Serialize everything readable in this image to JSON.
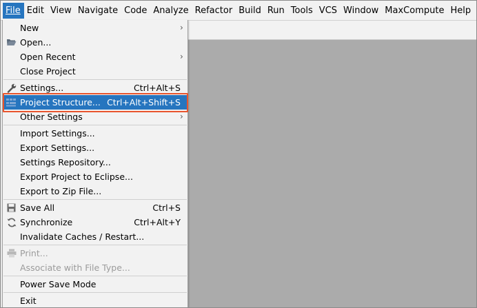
{
  "menubar": {
    "items": [
      "File",
      "Edit",
      "View",
      "Navigate",
      "Code",
      "Analyze",
      "Refactor",
      "Build",
      "Run",
      "Tools",
      "VCS",
      "Window",
      "MaxCompute",
      "Help"
    ]
  },
  "file_menu": {
    "new": "New",
    "open": "Open...",
    "open_recent": "Open Recent",
    "close_project": "Close Project",
    "settings": "Settings...",
    "settings_shortcut": "Ctrl+Alt+S",
    "project_structure": "Project Structure...",
    "project_structure_shortcut": "Ctrl+Alt+Shift+S",
    "other_settings": "Other Settings",
    "import_settings": "Import Settings...",
    "export_settings": "Export Settings...",
    "settings_repository": "Settings Repository...",
    "export_eclipse": "Export Project to Eclipse...",
    "export_zip": "Export to Zip File...",
    "save_all": "Save All",
    "save_all_shortcut": "Ctrl+S",
    "synchronize": "Synchronize",
    "synchronize_shortcut": "Ctrl+Alt+Y",
    "invalidate_caches": "Invalidate Caches / Restart...",
    "print": "Print...",
    "associate_file_type": "Associate with File Type...",
    "power_save_mode": "Power Save Mode",
    "exit": "Exit"
  },
  "colors": {
    "selection": "#2675bf",
    "highlight_border": "#e8542d",
    "menu_bg": "#f2f2f2",
    "editor_bg": "#ababab"
  },
  "icons": {
    "open": "folder-open-icon",
    "settings": "wrench-icon",
    "project_structure": "project-structure-icon",
    "save_all": "save-icon",
    "synchronize": "refresh-icon",
    "print": "printer-icon"
  }
}
